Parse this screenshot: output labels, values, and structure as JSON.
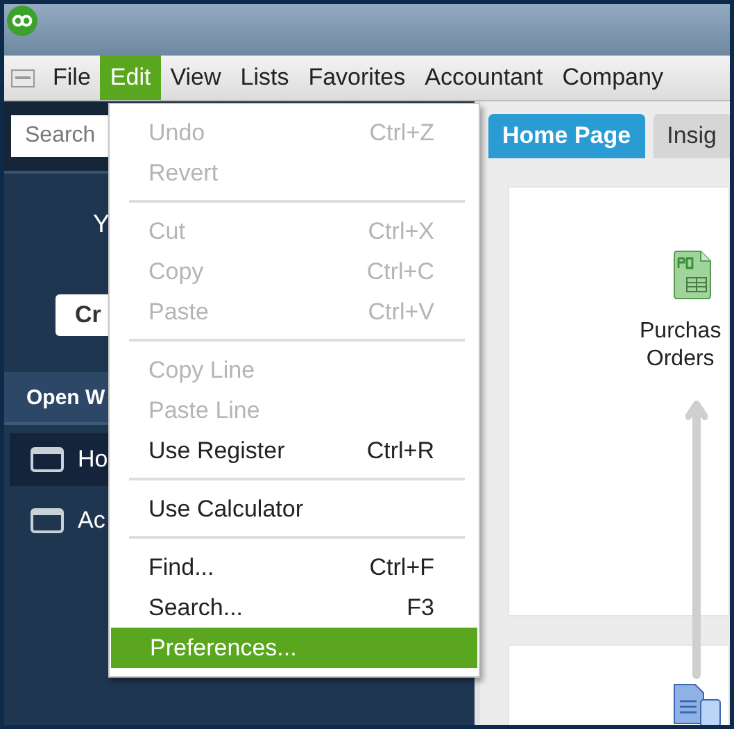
{
  "menu_bar": [
    {
      "label": "File",
      "selected": false
    },
    {
      "label": "Edit",
      "selected": true
    },
    {
      "label": "View",
      "selected": false
    },
    {
      "label": "Lists",
      "selected": false
    },
    {
      "label": "Favorites",
      "selected": false
    },
    {
      "label": "Accountant",
      "selected": false
    },
    {
      "label": "Company",
      "selected": false
    }
  ],
  "sidebar": {
    "search": {
      "placeholder": "Search"
    },
    "greeting": "Y",
    "button": "Cr",
    "section_header": "Open W",
    "items": [
      {
        "label": "Ho",
        "selected": true
      },
      {
        "label": "Ac",
        "selected": false
      }
    ]
  },
  "tabs": [
    {
      "label": "Home Page",
      "selected": true
    },
    {
      "label": "Insig",
      "selected": false
    }
  ],
  "home": {
    "purchase_orders": [
      "Purchas",
      "Orders"
    ]
  },
  "edit_menu": [
    {
      "kind": "item",
      "label": "Undo",
      "shortcut": "Ctrl+Z",
      "disabled": true,
      "selected": false
    },
    {
      "kind": "item",
      "label": "Revert",
      "disabled": true,
      "selected": false
    },
    {
      "kind": "separator"
    },
    {
      "kind": "item",
      "label": "Cut",
      "shortcut": "Ctrl+X",
      "disabled": true,
      "selected": false
    },
    {
      "kind": "item",
      "label": "Copy",
      "shortcut": "Ctrl+C",
      "disabled": true,
      "selected": false
    },
    {
      "kind": "item",
      "label": "Paste",
      "shortcut": "Ctrl+V",
      "disabled": true,
      "selected": false
    },
    {
      "kind": "separator"
    },
    {
      "kind": "item",
      "label": "Copy Line",
      "disabled": true,
      "selected": false
    },
    {
      "kind": "item",
      "label": "Paste Line",
      "disabled": true,
      "selected": false
    },
    {
      "kind": "item",
      "label": "Use Register",
      "shortcut": "Ctrl+R",
      "disabled": false,
      "selected": false
    },
    {
      "kind": "separator"
    },
    {
      "kind": "item",
      "label": "Use Calculator",
      "disabled": false,
      "selected": false
    },
    {
      "kind": "separator"
    },
    {
      "kind": "item",
      "label": "Find...",
      "shortcut": "Ctrl+F",
      "disabled": false,
      "selected": false
    },
    {
      "kind": "item",
      "label": "Search...",
      "shortcut": "F3",
      "disabled": false,
      "selected": false
    },
    {
      "kind": "item",
      "label": "Preferences...",
      "disabled": false,
      "selected": true
    }
  ]
}
